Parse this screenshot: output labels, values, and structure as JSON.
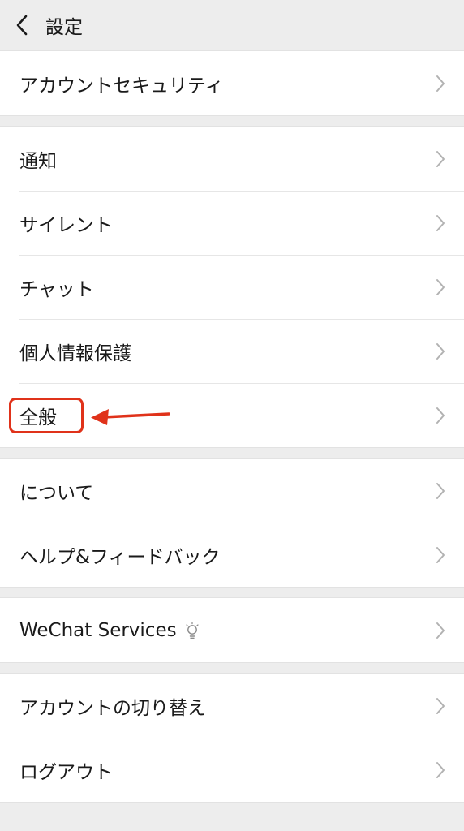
{
  "header": {
    "title": "設定"
  },
  "groups": [
    {
      "items": [
        {
          "label": "アカウントセキュリティ"
        }
      ]
    },
    {
      "items": [
        {
          "label": "通知"
        },
        {
          "label": "サイレント"
        },
        {
          "label": "チャット"
        },
        {
          "label": "個人情報保護"
        },
        {
          "label": "全般"
        }
      ]
    },
    {
      "items": [
        {
          "label": "について"
        },
        {
          "label": "ヘルプ&フィードバック"
        }
      ]
    },
    {
      "items": [
        {
          "label": "WeChat Services",
          "icon": "lightbulb-icon"
        }
      ]
    },
    {
      "items": [
        {
          "label": "アカウントの切り替え"
        },
        {
          "label": "ログアウト"
        }
      ]
    }
  ],
  "annotation": {
    "highlight_color": "#e0321a",
    "target": "全般"
  },
  "colors": {
    "background": "#ededed",
    "row_background": "#ffffff",
    "chevron": "#b2b2b2"
  }
}
